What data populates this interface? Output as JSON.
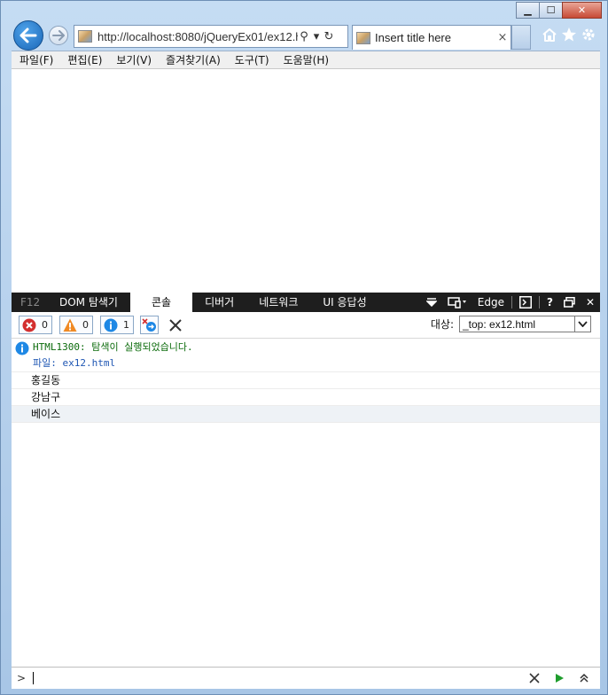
{
  "window": {
    "minimize_glyph": "▁",
    "maximize_glyph": "☐",
    "close_glyph": "✕"
  },
  "nav": {
    "url": "http://localhost:8080/jQueryEx01/ex12.ht",
    "tab_title": "Insert title here",
    "tab_close": "×",
    "search_glyph": "⚲",
    "dropdown_glyph": "▾",
    "refresh_glyph": "↻"
  },
  "menu": {
    "items": [
      "파일(F)",
      "편집(E)",
      "보기(V)",
      "즐겨찾기(A)",
      "도구(T)",
      "도움말(H)"
    ]
  },
  "devtools": {
    "f12_label": "F12",
    "tabs": [
      "DOM 탐색기",
      "콘솔",
      "디버거",
      "네트워크",
      "UI 응답성"
    ],
    "active_tab_index": 1,
    "mode_label": "Edge",
    "help_glyph": "?",
    "close_glyph": "✕",
    "counters": {
      "errors": "0",
      "warnings": "0",
      "info": "1"
    },
    "target_label": "대상:",
    "target_value": "_top: ex12.html",
    "prompt_glyph": ">"
  },
  "console": {
    "message": "HTML1300: 탐색이 실행되었습니다.",
    "file": "파일: ex12.html",
    "logs": [
      "홍길동",
      "강남구",
      "베이스"
    ]
  },
  "colors": {
    "accent": "#1a67b8",
    "devtools_tab_bg": "#1e1e1e",
    "info_blue": "#1e88e5",
    "warning_orange": "#f08a24",
    "error_red": "#d32f2f",
    "run_green": "#1f9d2d"
  }
}
